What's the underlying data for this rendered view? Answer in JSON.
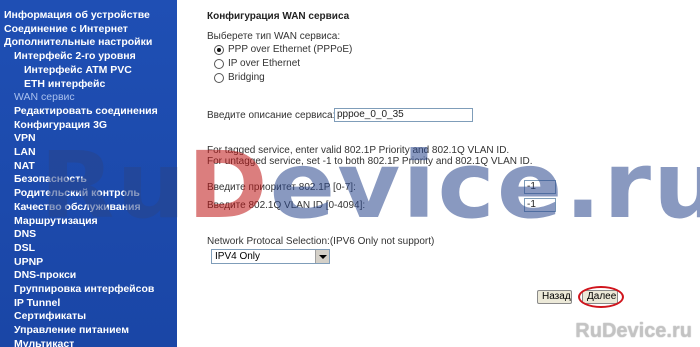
{
  "sidebar": {
    "items": [
      {
        "label": "Информация об устройстве",
        "level": 0
      },
      {
        "label": "Соединение с Интернет",
        "level": 0
      },
      {
        "label": "Дополнительные настройки",
        "level": 0
      },
      {
        "label": "Интерфейс 2-го уровня",
        "level": 1
      },
      {
        "label": "Интерфейс ATM PVC",
        "level": 2
      },
      {
        "label": "ETH интерфейс",
        "level": 2
      },
      {
        "label": "WAN сервис",
        "level": 1,
        "active": true
      },
      {
        "label": "Редактировать соединения",
        "level": 1
      },
      {
        "label": "Конфигурация 3G",
        "level": 1
      },
      {
        "label": "VPN",
        "level": 1
      },
      {
        "label": "LAN",
        "level": 1
      },
      {
        "label": "NAT",
        "level": 1
      },
      {
        "label": "Безопасность",
        "level": 1
      },
      {
        "label": "Родительский контроль",
        "level": 1
      },
      {
        "label": "Качество обслуживания",
        "level": 1
      },
      {
        "label": "Маршрутизация",
        "level": 1
      },
      {
        "label": "DNS",
        "level": 1
      },
      {
        "label": "DSL",
        "level": 1
      },
      {
        "label": "UPNP",
        "level": 1
      },
      {
        "label": "DNS-прокси",
        "level": 1
      },
      {
        "label": "Группировка интерфейсов",
        "level": 1
      },
      {
        "label": "IP Tunnel",
        "level": 1
      },
      {
        "label": "Сертификаты",
        "level": 1
      },
      {
        "label": "Управление питанием",
        "level": 1
      },
      {
        "label": "Мультикаст",
        "level": 1
      }
    ]
  },
  "main": {
    "title": "Конфигурация WAN сервиса",
    "service_type_prompt": "Выберете тип WAN сервиса:",
    "service_types": [
      {
        "label": "PPP over Ethernet (PPPoE)",
        "checked": true
      },
      {
        "label": "IP over Ethernet",
        "checked": false
      },
      {
        "label": "Bridging",
        "checked": false
      }
    ],
    "description_label": "Введите описание сервиса:",
    "description_value": "pppoe_0_0_35",
    "vlan_note_1": "For tagged service, enter valid 802.1P Priority and 802.1Q VLAN ID.",
    "vlan_note_2": "For untagged service, set -1 to both 802.1P Priority and 802.1Q VLAN ID.",
    "priority_label": "Введите приоритет 802.1P [0-7]:",
    "priority_value": "-1",
    "vlan_id_label": "Введите 802.1Q VLAN ID [0-4094]:",
    "vlan_id_value": "-1",
    "protocol_label": "Network Protocal Selection:(IPV6 Only not support)",
    "protocol_selected": "IPV4 Only",
    "back_label": "Назад",
    "next_label": "Далее"
  },
  "watermark": {
    "left": "Ru",
    "a": "D",
    "right": "evice.ru",
    "corner": "RuDevice.ru"
  },
  "colors": {
    "sidebar_bg": "#1a48a8",
    "highlight": "#d0141c"
  }
}
